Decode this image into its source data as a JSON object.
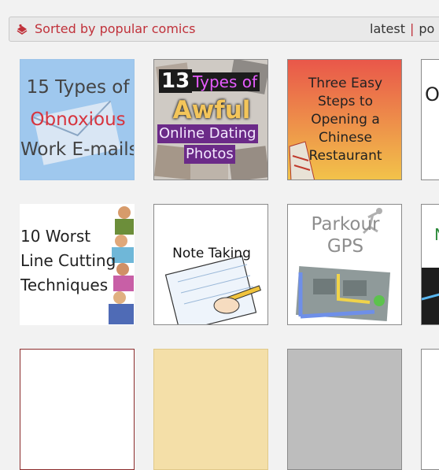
{
  "header": {
    "sort_label": "Sorted by popular comics",
    "nav_latest": "latest",
    "nav_separator": "|",
    "nav_popular": "po",
    "accent_color": "#c0313a"
  },
  "comics": [
    {
      "lines": [
        "15 Types of",
        "Obnoxious",
        "Work E-mails"
      ]
    },
    {
      "lines": [
        "13",
        "Types of",
        "Awful",
        "Online Dating",
        "Photos"
      ]
    },
    {
      "lines": [
        "Three Easy",
        "Steps to",
        "Opening a",
        "Chinese",
        "Restaurant"
      ]
    },
    {
      "lines": [
        "O"
      ]
    },
    {
      "lines": [
        "10 Worst",
        "Line Cutting",
        "Techniques"
      ]
    },
    {
      "lines": [
        "Note Taking"
      ]
    },
    {
      "lines": [
        "Parkour",
        "GPS"
      ]
    },
    {
      "lines": [
        "N"
      ]
    }
  ]
}
